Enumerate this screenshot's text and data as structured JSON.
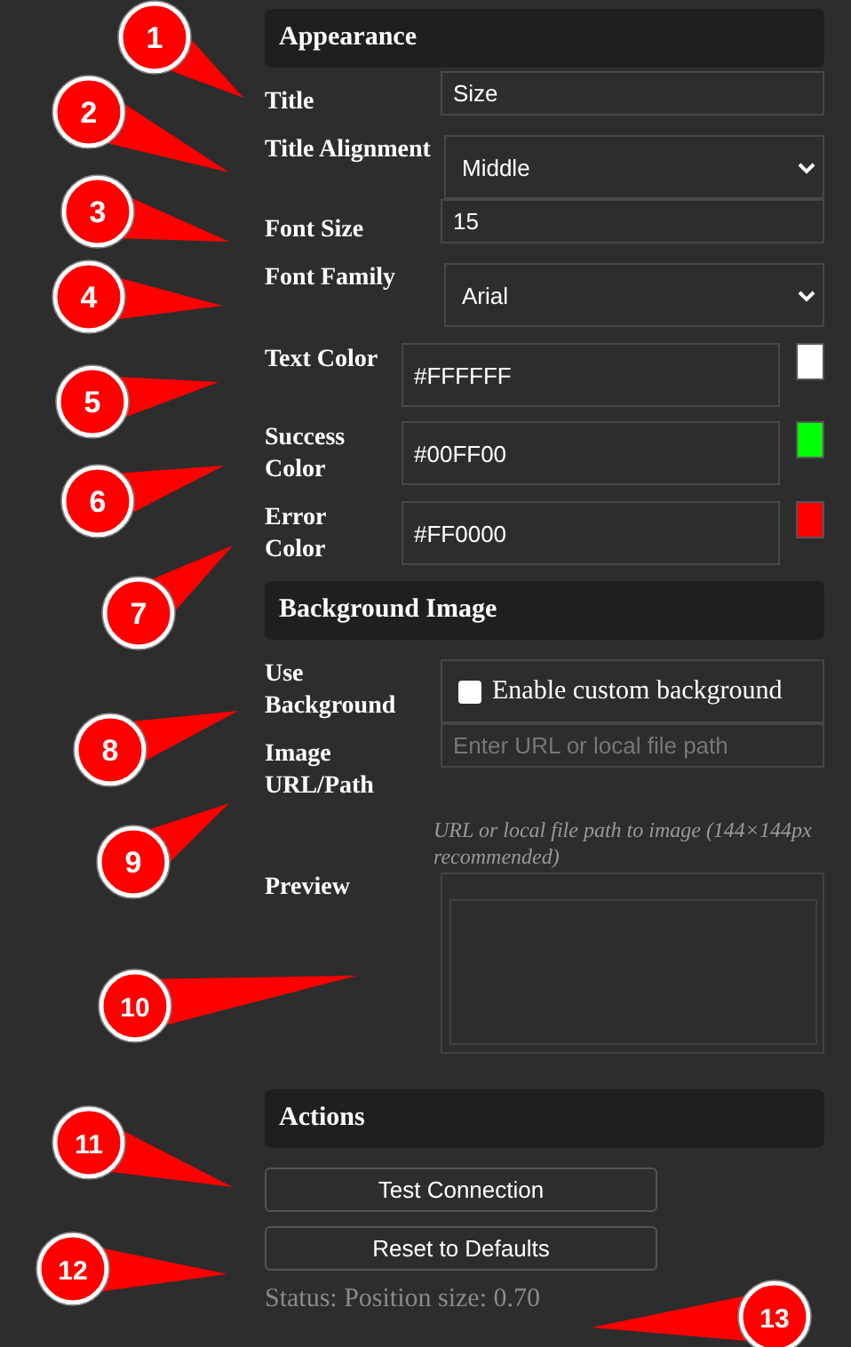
{
  "sections": [
    {
      "title": "Appearance",
      "rows": [
        {
          "kind": "text",
          "label": "Title",
          "value": "Size"
        },
        {
          "kind": "select",
          "label": "Title Alignment",
          "value": "Middle"
        },
        {
          "kind": "text",
          "label": "Font Size",
          "value": "15"
        },
        {
          "kind": "select",
          "label": "Font Family",
          "value": "Arial"
        },
        {
          "kind": "color",
          "label": "Text Color",
          "value": "#FFFFFF",
          "color": "#ffffff"
        },
        {
          "kind": "color",
          "label": "Success Color",
          "value": "#00FF00",
          "color": "#00ff00"
        },
        {
          "kind": "color",
          "label": "Error Color",
          "value": "#FF0000",
          "color": "#ff0000"
        }
      ]
    },
    {
      "title": "Background Image",
      "rows": [
        {
          "kind": "checkbox",
          "label": "Use Background",
          "text": "Enable custom background",
          "checked": false
        },
        {
          "kind": "text",
          "label": "Image URL/Path",
          "placeholder": "Enter URL or local file path",
          "hint": "URL or local file path to image (144×144px recommended)"
        },
        {
          "kind": "preview",
          "label": "Preview"
        }
      ]
    },
    {
      "title": "Actions",
      "buttons": [
        "Test Connection",
        "Reset to Defaults"
      ],
      "status": "Status: Position size: 0.70"
    }
  ],
  "callouts": [
    {
      "label": "1"
    },
    {
      "label": "2"
    },
    {
      "label": "3"
    },
    {
      "label": "4"
    },
    {
      "label": "5"
    },
    {
      "label": "6"
    },
    {
      "label": "7"
    },
    {
      "label": "8"
    },
    {
      "label": "9"
    },
    {
      "label": "10"
    },
    {
      "label": "11"
    },
    {
      "label": "12"
    },
    {
      "label": "13"
    }
  ]
}
